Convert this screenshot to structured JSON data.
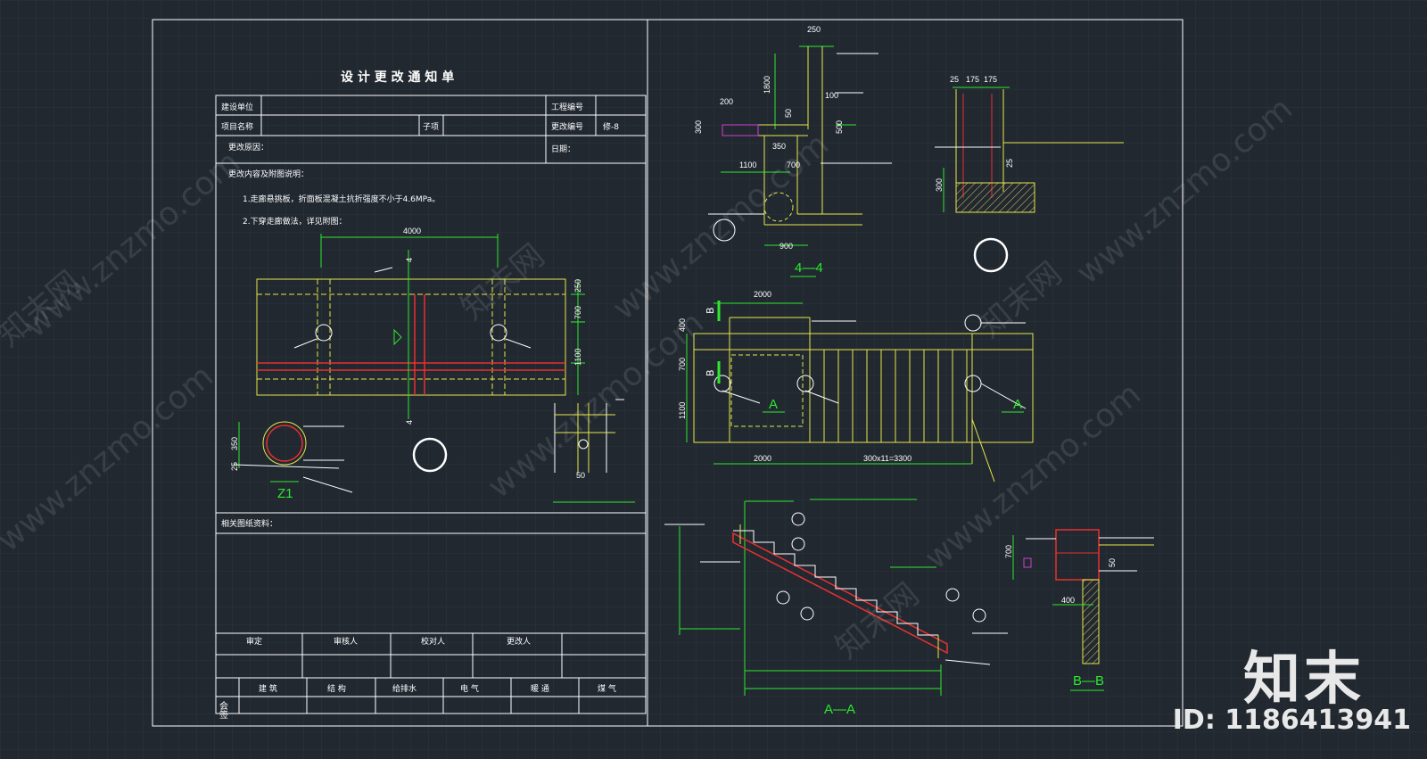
{
  "form": {
    "title": "设 计 更 改 通 知 单",
    "rows": {
      "client_label": "建设单位",
      "project_no_label": "工程编号",
      "project_name_label": "项目名称",
      "subitem_label": "子项",
      "change_no_label": "更改编号",
      "change_no_value": "修-8",
      "reason_label": "更改原因：",
      "date_label": "日期：",
      "content_label": "更改内容及附图说明：",
      "note1": "1.走廊悬挑板，折面板混凝土抗折强度不小于4.6MPa。",
      "note2": "2.下穿走廊做法，详见附图：",
      "related_label": "相关图纸资料："
    },
    "approvals": [
      "审定",
      "审核人",
      "校对人",
      "更改人"
    ],
    "countersign_label": "会签",
    "disciplines": [
      "建 筑",
      "结 构",
      "给排水",
      "电 气",
      "暖 通",
      "煤 气"
    ]
  },
  "drawing_left": {
    "dims": [
      "4000",
      "250",
      "700",
      "1100",
      "350",
      "25",
      "50"
    ],
    "section_mark": "4",
    "column_label": "Z1"
  },
  "drawing_right": {
    "section_44": {
      "label": "4—4",
      "dims": [
        "250",
        "1800",
        "100",
        "200",
        "50",
        "300",
        "350",
        "500",
        "1100",
        "700",
        "900"
      ]
    },
    "detail": {
      "dims": [
        "25",
        "175",
        "175",
        "25",
        "300"
      ]
    },
    "plan": {
      "dims": [
        "2000",
        "400",
        "700",
        "1100",
        "2000",
        "300x11=3300"
      ],
      "mark_a": "A",
      "mark_b": "B"
    },
    "section_aa": {
      "label": "A—A"
    },
    "section_bb": {
      "label": "B—B",
      "dims": [
        "700",
        "400",
        "50"
      ]
    }
  },
  "watermark": {
    "text_cn": "知末网",
    "text_url": "www.znzmo.com"
  },
  "brand": {
    "logo": "知末",
    "id_text": "ID: 1186413941"
  },
  "colors": {
    "background": "#212830",
    "white": "#ffffff",
    "yellow": "#e8e84a",
    "green": "#2ee82e",
    "red": "#e83030",
    "magenta": "#d040d0"
  }
}
